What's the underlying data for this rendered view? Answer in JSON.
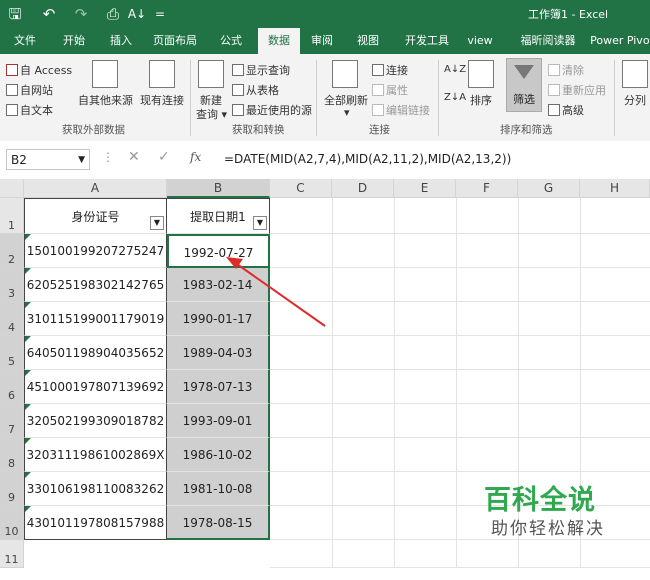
{
  "window": {
    "title": "工作簿1 - Excel"
  },
  "quick_access": {
    "save": "🖫",
    "undo": "↶",
    "redo": "↷",
    "print_preview": "⎙",
    "sort": "A↓",
    "customize": "="
  },
  "menu": {
    "tabs": [
      "文件",
      "开始",
      "插入",
      "页面布局",
      "公式",
      "数据",
      "审阅",
      "视图",
      "开发工具",
      "view",
      "福昕阅读器",
      "Power Pivot"
    ],
    "active": "数据"
  },
  "ribbon": {
    "get_external": {
      "access": "自 Access",
      "web": "自网站",
      "text": "自文本",
      "other": "自其他来源",
      "existing": "现有连接",
      "label": "获取外部数据"
    },
    "transform": {
      "new_query": "新建",
      "new_query2": "查询 ▾",
      "show_queries": "显示查询",
      "from_table": "从表格",
      "recent_sources": "最近使用的源",
      "label": "获取和转换"
    },
    "connections": {
      "refresh_all": "全部刷新",
      "refresh_arrow": "▾",
      "connections": "连接",
      "properties": "属性",
      "edit_links": "编辑链接",
      "label": "连接"
    },
    "sort_filter": {
      "sort_az": "A↓Z",
      "sort_za": "Z↓A",
      "sort": "排序",
      "filter": "筛选",
      "clear": "清除",
      "reapply": "重新应用",
      "advanced": "高级",
      "label": "排序和筛选"
    },
    "split": {
      "label": "分列"
    }
  },
  "formula_bar": {
    "name_box": "B2",
    "fx": "fx",
    "formula": "=DATE(MID(A2,7,4),MID(A2,11,2),MID(A2,13,2))"
  },
  "columns": [
    "A",
    "B",
    "C",
    "D",
    "E",
    "F",
    "G",
    "H"
  ],
  "rows": [
    "1",
    "2",
    "3",
    "4",
    "5",
    "6",
    "7",
    "8",
    "9",
    "10",
    "11"
  ],
  "table": {
    "headers": {
      "id": "身份证号",
      "date": "提取日期1"
    },
    "ids": [
      "150100199207275247",
      "620525198302142765",
      "310115199001179019",
      "640501198904035652",
      "451000197807139692",
      "320502199309018782",
      "32031119861002869X",
      "330106198110083262",
      "430101197808157988"
    ],
    "dates": [
      "1992-07-27",
      "1983-02-14",
      "1990-01-17",
      "1989-04-03",
      "1978-07-13",
      "1993-09-01",
      "1986-10-02",
      "1981-10-08",
      "1978-08-15"
    ]
  },
  "watermark": {
    "title": "百科全说",
    "subtitle": "助你轻松解决"
  },
  "colors": {
    "excel_green": "#217346",
    "selection_fill": "#cfcfcf",
    "arrow": "#e02a2a",
    "watermark_green": "#2ea94f"
  }
}
